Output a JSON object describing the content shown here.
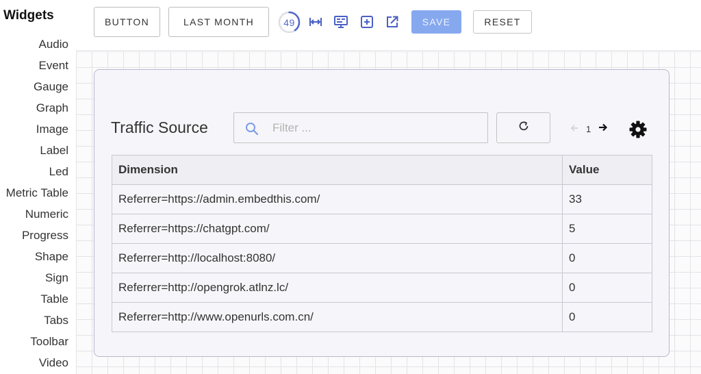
{
  "sidebar": {
    "title": "Widgets",
    "items": [
      {
        "label": "Audio"
      },
      {
        "label": "Event"
      },
      {
        "label": "Gauge"
      },
      {
        "label": "Graph"
      },
      {
        "label": "Image"
      },
      {
        "label": "Label"
      },
      {
        "label": "Led"
      },
      {
        "label": "Metric Table"
      },
      {
        "label": "Numeric"
      },
      {
        "label": "Progress"
      },
      {
        "label": "Shape"
      },
      {
        "label": "Sign"
      },
      {
        "label": "Table"
      },
      {
        "label": "Tabs"
      },
      {
        "label": "Toolbar"
      },
      {
        "label": "Video"
      }
    ]
  },
  "toolbar": {
    "button_label": "BUTTON",
    "range_label": "LAST MONTH",
    "counter_value": "49",
    "counter_progress": 0.4,
    "save_label": "SAVE",
    "reset_label": "RESET",
    "icons": [
      "fit-width-icon",
      "monitor-icon",
      "add-box-icon",
      "open-external-icon"
    ]
  },
  "widget": {
    "title": "Traffic Source",
    "filter_placeholder": "Filter ...",
    "filter_value": "",
    "page_number": "1",
    "table": {
      "columns": [
        "Dimension",
        "Value"
      ],
      "rows": [
        [
          "Referrer=https://admin.embedthis.com/",
          "33"
        ],
        [
          "Referrer=https://chatgpt.com/",
          "5"
        ],
        [
          "Referrer=http://localhost:8080/",
          "0"
        ],
        [
          "Referrer=http://opengrok.atlnz.lc/",
          "0"
        ],
        [
          "Referrer=http://www.openurls.com.cn/",
          "0"
        ]
      ]
    }
  },
  "colors": {
    "accent": "#5468c8",
    "save_bg": "#86a8ee",
    "card_bg": "#f6f5f9",
    "header_bg": "#efeef2"
  }
}
